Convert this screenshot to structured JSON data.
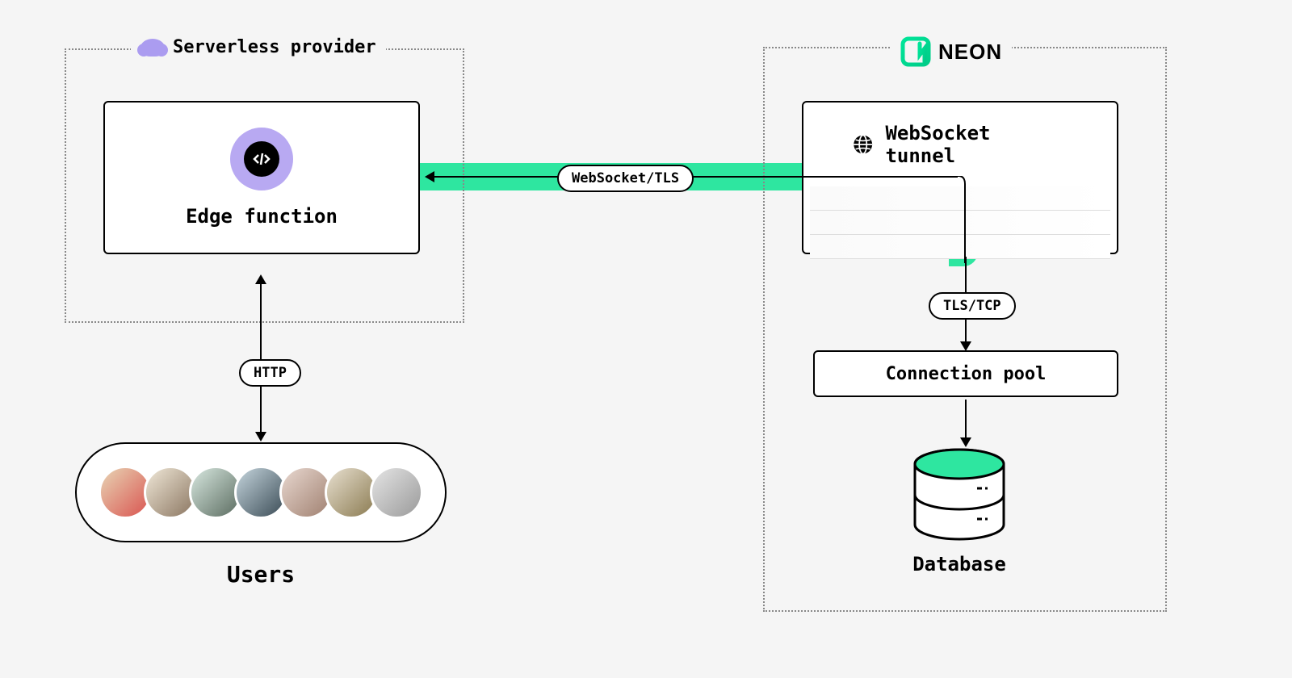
{
  "serverless": {
    "title": "Serverless provider",
    "edge_function_label": "Edge function"
  },
  "neon": {
    "brand": "NEON",
    "websocket_label": "WebSocket tunnel",
    "connection_pool_label": "Connection pool",
    "database_label": "Database"
  },
  "users": {
    "label": "Users"
  },
  "connections": {
    "http": "HTTP",
    "websocket_tls": "WebSocket/TLS",
    "tls_tcp": "TLS/TCP"
  },
  "colors": {
    "accent_green": "#2ee6a0",
    "purple": "#b8a9f2",
    "cloud": "#ab9cf0"
  }
}
